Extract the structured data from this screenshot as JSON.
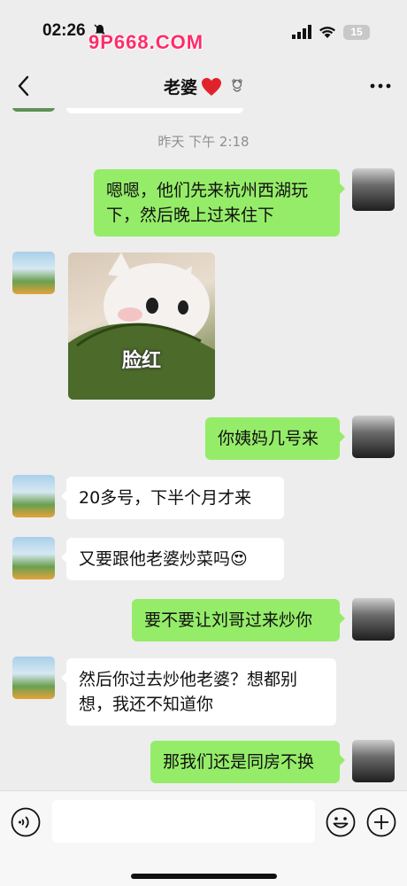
{
  "status_bar": {
    "time": "02:26",
    "watermark": "9P668.COM",
    "battery": "15"
  },
  "header": {
    "title": "老婆"
  },
  "chat": {
    "timestamp": "昨天 下午 2:18",
    "messages": [
      {
        "side": "right",
        "text": "嗯嗯，他们先来杭州西湖玩下，然后晚上过来住下"
      },
      {
        "side": "left",
        "type": "sticker",
        "text": "脸红"
      },
      {
        "side": "right",
        "text": "你姨妈几号来"
      },
      {
        "side": "left",
        "text": "20多号，下半个月才来"
      },
      {
        "side": "left",
        "text": "又要跟他老婆炒菜吗😍"
      },
      {
        "side": "right",
        "text": "要不要让刘哥过来炒你"
      },
      {
        "side": "left",
        "text": "然后你过去炒他老婆？想都别想，我还不知道你"
      },
      {
        "side": "right",
        "text": "那我们还是同房不换"
      }
    ]
  },
  "input_bar": {
    "placeholder": ""
  },
  "colors": {
    "background": "#ededed",
    "self_bubble": "#95ec69",
    "other_bubble": "#ffffff",
    "watermark": "#ff2b6a"
  },
  "icons": [
    "back-chevron-icon",
    "heart-icon",
    "bear-icon",
    "more-icon",
    "voice-icon",
    "emoji-icon",
    "plus-icon",
    "signal-icon",
    "wifi-icon",
    "battery-icon",
    "bell-slash-icon"
  ]
}
